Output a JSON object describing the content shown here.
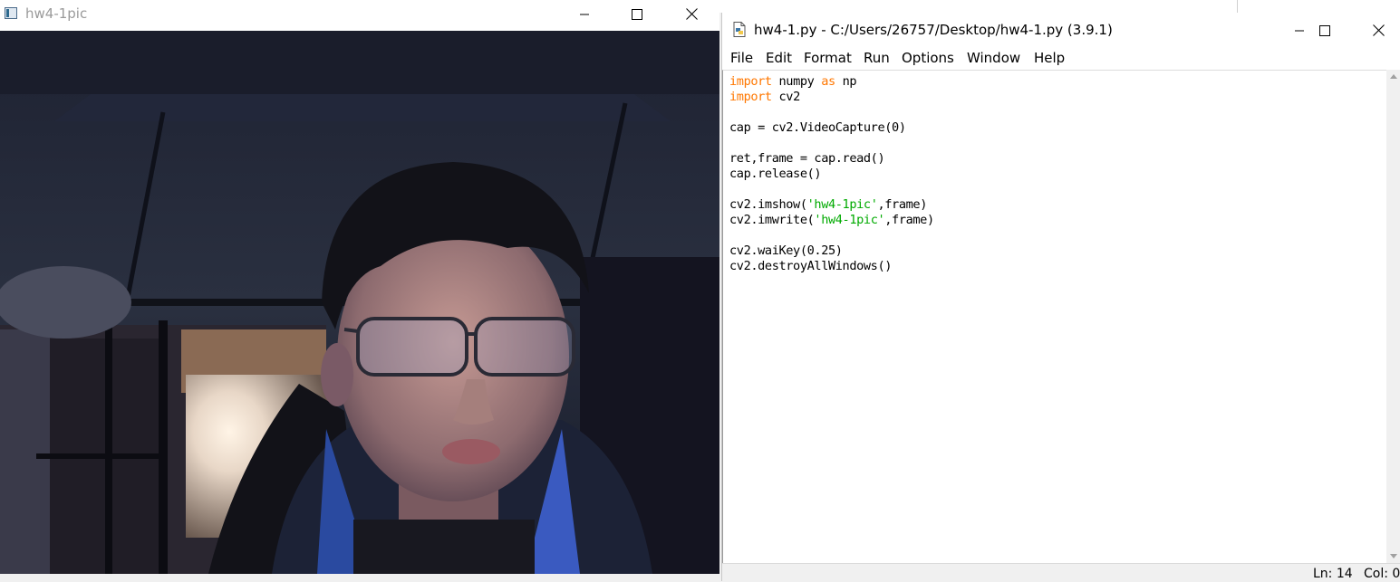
{
  "image_window": {
    "title": "hw4-1pic",
    "buttons": {
      "minimize": "minimize",
      "maximize": "maximize",
      "close": "close"
    },
    "content": "webcam frame of a person wearing glasses in a dim dorm room"
  },
  "idle_window": {
    "title": "hw4-1.py - C:/Users/26757/Desktop/hw4-1.py (3.9.1)",
    "menu": [
      "File",
      "Edit",
      "Format",
      "Run",
      "Options",
      "Window",
      "Help"
    ],
    "code": [
      [
        {
          "t": "import",
          "c": "kw"
        },
        {
          "t": " numpy "
        },
        {
          "t": "as",
          "c": "kw"
        },
        {
          "t": " np"
        }
      ],
      [
        {
          "t": "import",
          "c": "kw"
        },
        {
          "t": " cv2"
        }
      ],
      [],
      [
        {
          "t": "cap = cv2.VideoCapture(0)"
        }
      ],
      [],
      [
        {
          "t": "ret,frame = cap.read()"
        }
      ],
      [
        {
          "t": "cap.release()"
        }
      ],
      [],
      [
        {
          "t": "cv2.imshow("
        },
        {
          "t": "'hw4-1pic'",
          "c": "str"
        },
        {
          "t": ",frame)"
        }
      ],
      [
        {
          "t": "cv2.imwrite("
        },
        {
          "t": "'hw4-1pic'",
          "c": "str"
        },
        {
          "t": ",frame)"
        }
      ],
      [],
      [
        {
          "t": "cv2.waiKey(0.25)"
        }
      ],
      [
        {
          "t": "cv2.destroyAllWindows()"
        }
      ]
    ],
    "status": {
      "line": "Ln: 14",
      "col": "Col: 0"
    }
  },
  "colors": {
    "keyword": "#ff7700",
    "string": "#00aa00"
  }
}
